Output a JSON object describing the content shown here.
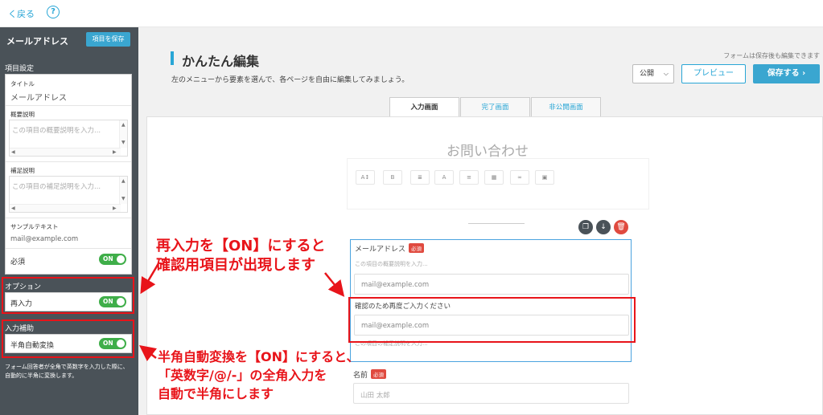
{
  "topbar": {
    "back_label": "く戻る",
    "help_label": "?"
  },
  "sidebar": {
    "title": "メールアドレス",
    "save_item_label": "項目を保存",
    "section_item_settings": "項目設定",
    "title_label": "タイトル",
    "title_value": "メールアドレス",
    "summary_label": "概要説明",
    "summary_placeholder": "この項目の概要説明を入力...",
    "supplement_label": "補足説明",
    "supplement_placeholder": "この項目の補足説明を入力...",
    "sample_label": "サンプルテキスト",
    "sample_value": "mail@example.com",
    "required_label": "必須",
    "required_toggle": "ON",
    "section_options": "オプション",
    "reentry_label": "再入力",
    "reentry_toggle": "ON",
    "section_input_assist": "入力補助",
    "halfwidth_label": "半角自動変換",
    "halfwidth_toggle": "ON",
    "note": "フォーム回答者が全角で英数字を入力した際に、自動的に半角に変換します。"
  },
  "main": {
    "title": "かんたん編集",
    "subtitle": "左のメニューから要素を選んで、各ページを自由に編集してみましょう。",
    "hint": "フォームは保存後も編集できます",
    "publish_label": "公開",
    "preview_label": "プレビュー",
    "save_label": "保存する ›",
    "tabs": [
      {
        "label": "入力画面"
      },
      {
        "label": "完了画面"
      },
      {
        "label": "非公開画面"
      }
    ],
    "form_title": "お問い合わせ",
    "toolbar": [
      "A↕",
      "B",
      "≣",
      "A",
      "≡",
      "▦",
      "∞",
      "▣"
    ],
    "field_email": {
      "label": "メールアドレス",
      "required": "必須",
      "desc": "この項目の概要説明を入力...",
      "placeholder": "mail@example.com",
      "confirm_label": "確認のため再度ご入力ください",
      "confirm_placeholder": "mail@example.com",
      "supplement": "この項目の補足説明を入力..."
    },
    "field_name": {
      "label": "名前",
      "required": "必須",
      "placeholder": "山田 太郎"
    }
  },
  "annotations": {
    "reentry_line1": "再入力を【ON】にすると",
    "reentry_line2": "確認用項目が出現します",
    "half_line1": "半角自動変換を【ON】にすると、",
    "half_line2": "「英数字/@/-」の全角入力を",
    "half_line3": "自動で半角にします"
  },
  "colors": {
    "accent": "#29a6d6",
    "toggle_on": "#3fae49",
    "annotation": "#e8141a",
    "sidebar_bg": "#4a5258"
  }
}
